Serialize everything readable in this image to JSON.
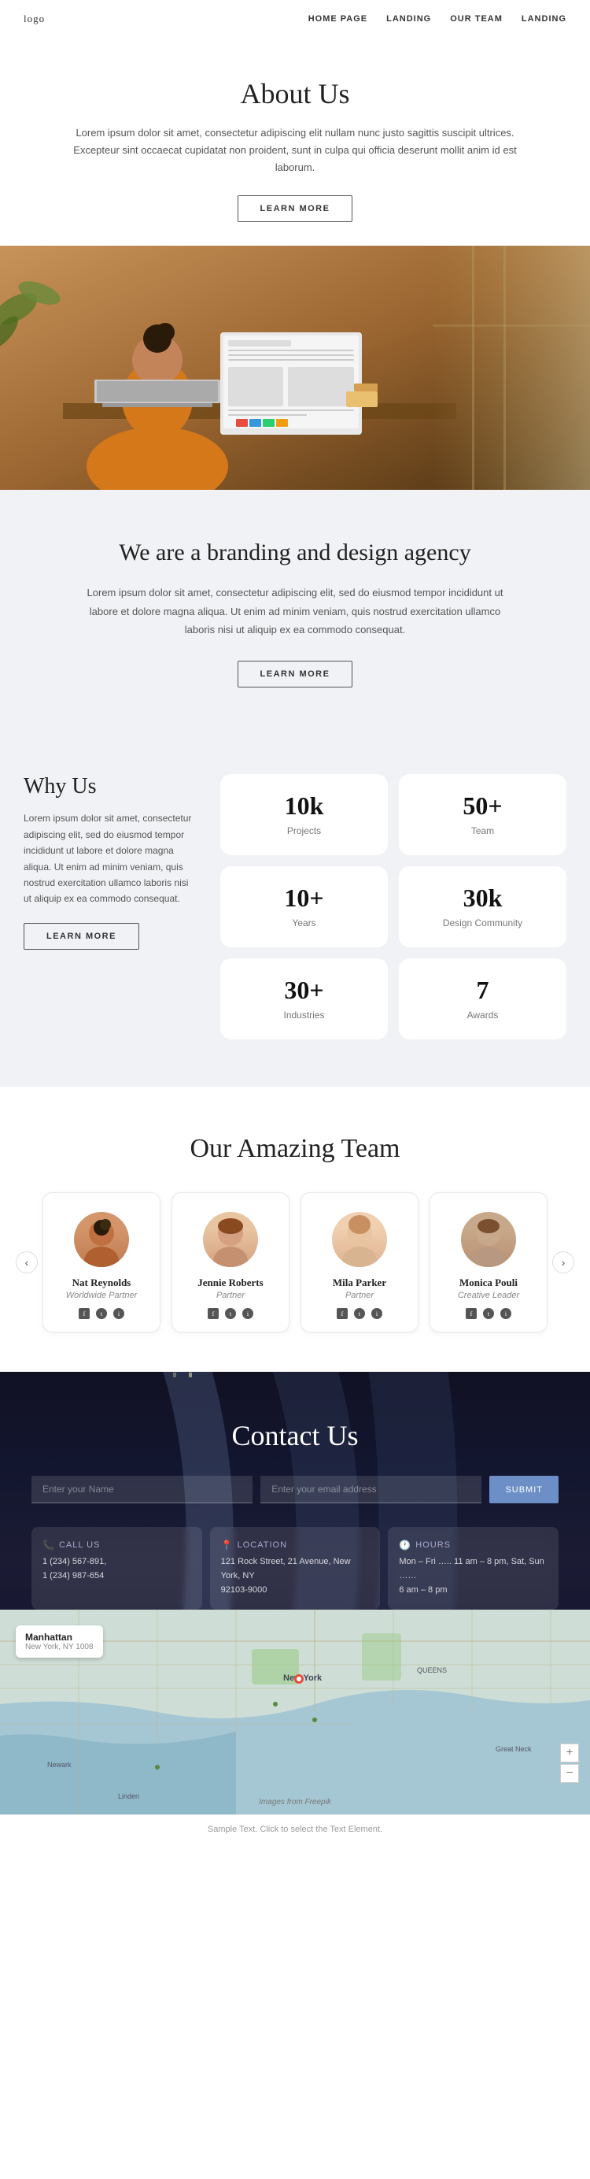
{
  "navbar": {
    "logo": "logo",
    "links": [
      {
        "label": "HOME PAGE",
        "href": "#"
      },
      {
        "label": "LANDING",
        "href": "#"
      },
      {
        "label": "OUR TEAM",
        "href": "#"
      },
      {
        "label": "LANDING",
        "href": "#"
      }
    ]
  },
  "about": {
    "title": "About Us",
    "description": "Lorem ipsum dolor sit amet, consectetur adipiscing elit nullam nunc justo sagittis suscipit ultrices. Excepteur sint occaecat cupidatat non proident, sunt in culpa qui officia deserunt mollit anim id est laborum.",
    "button_label": "LEARN MORE"
  },
  "branding": {
    "title": "We are a branding and design agency",
    "description": "Lorem ipsum dolor sit amet, consectetur adipiscing elit, sed do eiusmod tempor incididunt ut labore et dolore magna aliqua. Ut enim ad minim veniam, quis nostrud exercitation ullamco laboris nisi ut aliquip ex ea commodo consequat.",
    "button_label": "LEARN MORE"
  },
  "why_us": {
    "title": "Why Us",
    "description": "Lorem ipsum dolor sit amet, consectetur adipiscing elit, sed do eiusmod tempor incididunt ut labore et dolore magna aliqua. Ut enim ad minim veniam, quis nostrud exercitation ullamco laboris nisi ut aliquip ex ea commodo consequat.",
    "button_label": "LEARN MORE",
    "stats": [
      {
        "number": "10k",
        "label": "Projects"
      },
      {
        "number": "50+",
        "label": "Team"
      },
      {
        "number": "10+",
        "label": "Years"
      },
      {
        "number": "30k",
        "label": "Design Community"
      },
      {
        "number": "30+",
        "label": "Industries"
      },
      {
        "number": "7",
        "label": "Awards"
      }
    ]
  },
  "team": {
    "title": "Our Amazing Team",
    "members": [
      {
        "name": "Nat Reynolds",
        "role": "Worldwide Partner",
        "avatar_class": "avatar-m1"
      },
      {
        "name": "Jennie Roberts",
        "role": "Partner",
        "avatar_class": "avatar-f1"
      },
      {
        "name": "Mila Parker",
        "role": "Partner",
        "avatar_class": "avatar-f2"
      },
      {
        "name": "Monica Pouli",
        "role": "Creative Leader",
        "avatar_class": "avatar-f3"
      }
    ]
  },
  "contact": {
    "title": "Contact Us",
    "form": {
      "name_placeholder": "Enter your Name",
      "email_placeholder": "Enter your email address",
      "submit_label": "SUBMIT"
    },
    "info_cards": [
      {
        "icon": "📞",
        "title": "CALL US",
        "lines": [
          "1 (234) 567-891,",
          "1 (234) 987-654"
        ]
      },
      {
        "icon": "📍",
        "title": "LOCATION",
        "lines": [
          "121 Rock Street, 21 Avenue, New York, NY",
          "92103-9000"
        ]
      },
      {
        "icon": "🕐",
        "title": "HOURS",
        "lines": [
          "Mon – Fri ….. 11 am – 8 pm, Sat, Sun ……",
          "6 am – 8 pm"
        ]
      }
    ]
  },
  "map": {
    "location_name": "Manhattan",
    "location_sub": "New York, NY 1008",
    "center_label": "New York",
    "freepik_text": "Images from Freepik"
  },
  "footer": {
    "text": "Sample Text. Click to select the Text Element."
  }
}
